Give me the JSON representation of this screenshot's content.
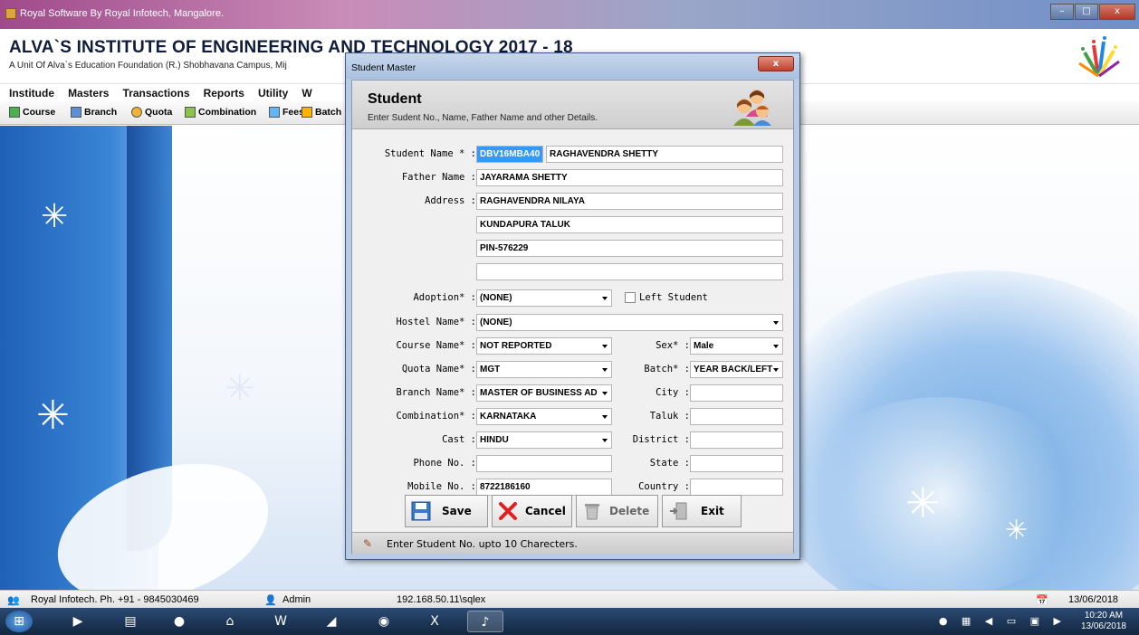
{
  "window": {
    "title": "Royal Software By Royal Infotech, Mangalore.",
    "controls": {
      "minimize": "–",
      "maximize": "□",
      "close": "x"
    }
  },
  "header": {
    "institute": "ALVA`S INSTITUTE OF ENGINEERING AND TECHNOLOGY  2017 - 18",
    "subtitle": "A Unit Of Alva`s Education Foundation (R.) Shobhavana Campus, Mij"
  },
  "menu": [
    "Institude",
    "Masters",
    "Transactions",
    "Reports",
    "Utility",
    "W"
  ],
  "toolbar": {
    "course": "Course",
    "branch": "Branch",
    "quota": "Quota",
    "combination": "Combination",
    "fees": "Fees",
    "batch": "Batch"
  },
  "dialog": {
    "title": "Student Master",
    "close": "x",
    "heading": "Student",
    "subheading": "Enter Sudent No., Name, Father Name and other Details.",
    "labels": {
      "student_name": "Student Name * :",
      "father_name": "Father Name :",
      "address": "Address :",
      "adoption": "Adoption* :",
      "left_student": "Left Student",
      "hostel": "Hostel Name* :",
      "course": "Course Name* :",
      "sex": "Sex* :",
      "quota": "Quota Name* :",
      "batch": "Batch* :",
      "branch": "Branch Name* :",
      "city": "City :",
      "combination": "Combination* :",
      "taluk": "Taluk :",
      "cast": "Cast :",
      "district": "District :",
      "phone": "Phone No. :",
      "state": "State :",
      "mobile": "Mobile No. :",
      "country": "Country :"
    },
    "values": {
      "student_no": "DBV16MBA40",
      "student_name": "RAGHAVENDRA SHETTY",
      "father_name": "JAYARAMA SHETTY",
      "address1": "RAGHAVENDRA NILAYA",
      "address2": "KUNDAPURA TALUK",
      "address3": "PIN-576229",
      "address4": "",
      "adoption": "(NONE)",
      "hostel": "(NONE)",
      "course": "NOT REPORTED",
      "sex": "Male",
      "quota": "MGT",
      "batch": "YEAR BACK/LEFT",
      "branch": "MASTER OF BUSINESS AD",
      "city": "",
      "combination": "KARNATAKA",
      "taluk": "",
      "cast": "HINDU",
      "district": "",
      "phone": "",
      "state": "",
      "mobile": "8722186160",
      "country": ""
    },
    "buttons": {
      "save": "Save",
      "cancel": "Cancel",
      "delete": "Delete",
      "exit": "Exit"
    },
    "status": "Enter Student No. upto 10 Charecters."
  },
  "statusbar": {
    "company": "Royal Infotech.  Ph. +91 - 9845030469",
    "user": "Admin",
    "server": "192.168.50.11\\sqlex",
    "date": "13/06/2018"
  },
  "taskbar": {
    "time": "10:20 AM",
    "date": "13/06/2018"
  }
}
